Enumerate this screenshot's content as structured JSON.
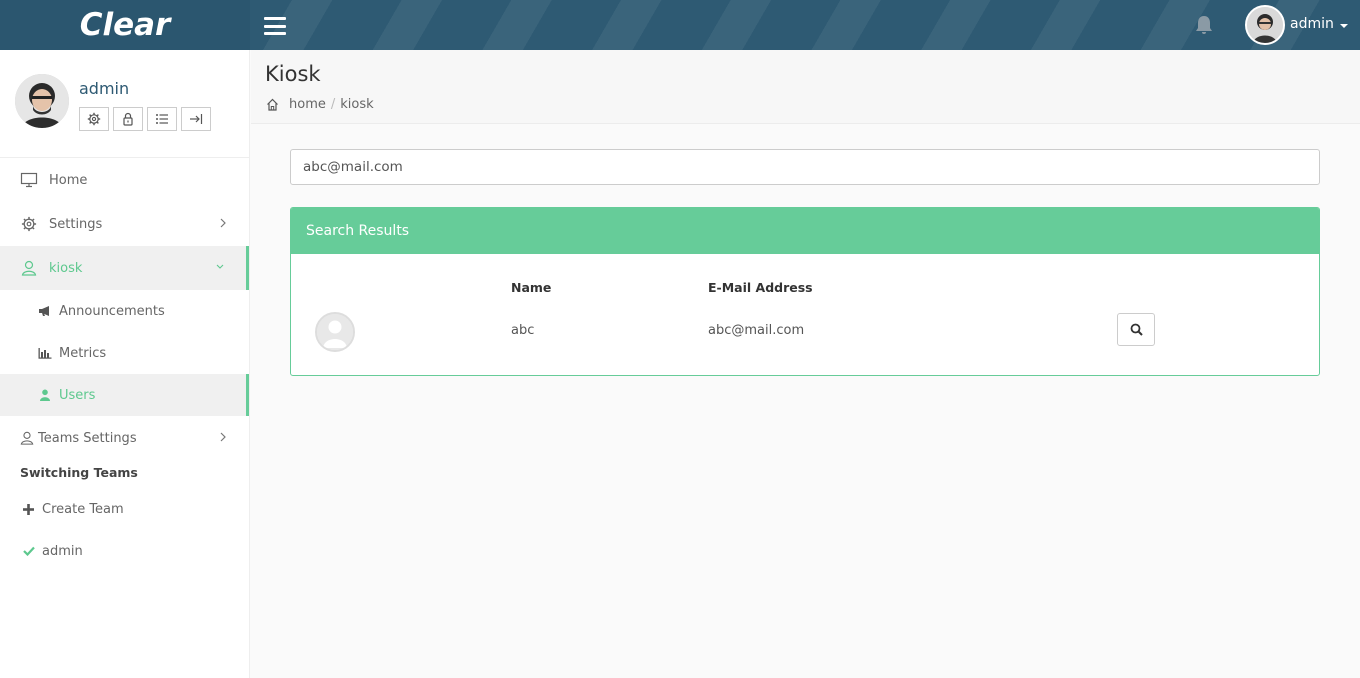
{
  "brand": {
    "name": "Clear"
  },
  "header": {
    "user_name": "admin"
  },
  "sidebar": {
    "profile_name": "admin",
    "tools": [
      "gear-icon",
      "lock-icon",
      "list-icon",
      "logout-icon"
    ],
    "menu": {
      "home": "Home",
      "settings": "Settings",
      "kiosk": "kiosk",
      "announcements": "Announcements",
      "metrics": "Metrics",
      "users": "Users",
      "teams_settings": "Teams Settings"
    },
    "switching_label": "Switching Teams",
    "create_team": "Create Team",
    "team_admin": "admin"
  },
  "page": {
    "title": "Kiosk",
    "breadcrumb": {
      "home": "home",
      "separator": "/",
      "current": "kiosk"
    }
  },
  "search": {
    "value": "abc@mail.com"
  },
  "results": {
    "heading": "Search Results",
    "columns": {
      "name": "Name",
      "email": "E-Mail Address"
    },
    "rows": [
      {
        "name": "abc",
        "email": "abc@mail.com"
      }
    ]
  },
  "colors": {
    "accent": "#66cc99",
    "topbar": "#2e5a73",
    "active_text": "#5dc88e"
  }
}
